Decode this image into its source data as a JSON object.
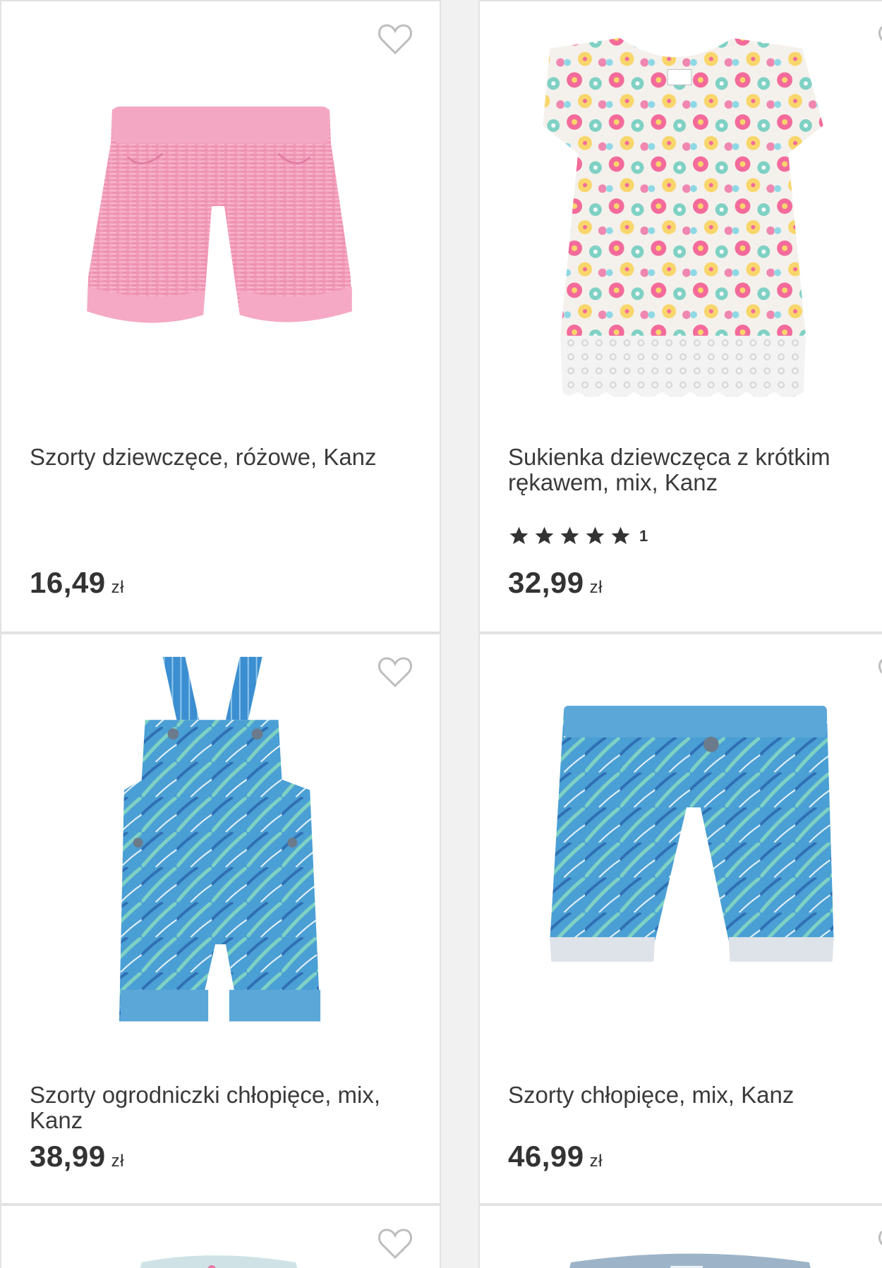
{
  "colors": {
    "background": "#f1f1f1",
    "card": "#ffffff",
    "border": "#e2e2e2",
    "text": "#333333",
    "heart": "#bdbdbd"
  },
  "products": [
    {
      "title": "Szorty dziewczęce, różowe, Kanz",
      "price": "16,49",
      "currency": "zł",
      "image": "pink-shorts"
    },
    {
      "title": "Sukienka dziewczęca z krótkim rękawem, mix, Kanz",
      "price": "32,99",
      "currency": "zł",
      "rating_stars": 5,
      "rating_count": "1",
      "image": "floral-dress"
    },
    {
      "title": "Szorty ogrodniczki chłopięce, mix, Kanz",
      "price": "38,99",
      "currency": "zł",
      "image": "blue-dungarees"
    },
    {
      "title": "Szorty chłopięce, mix, Kanz",
      "price": "46,99",
      "currency": "zł",
      "image": "blue-shorts"
    }
  ]
}
